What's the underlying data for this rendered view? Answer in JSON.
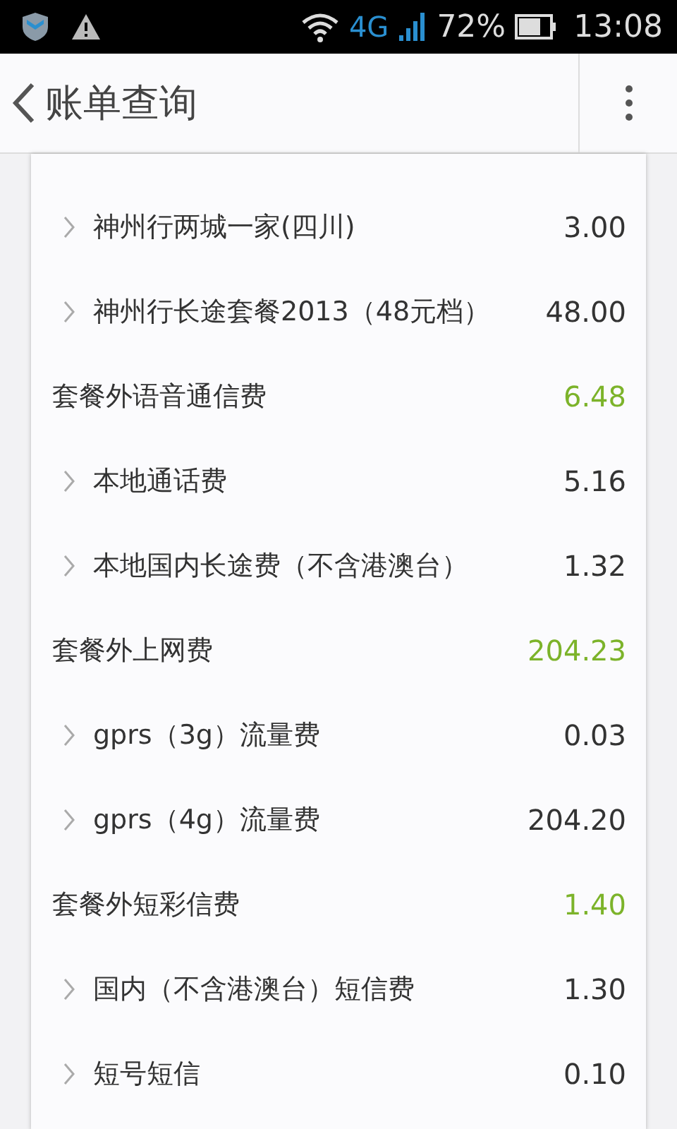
{
  "status_bar": {
    "network": "4G",
    "battery": "72%",
    "time": "13:08"
  },
  "app_bar": {
    "title": "账单查询"
  },
  "rows": [
    {
      "kind": "item",
      "label": "神州行两城一家(四川)",
      "amount": "3.00"
    },
    {
      "kind": "item",
      "label": "神州行长途套餐2013（48元档）",
      "amount": "48.00"
    },
    {
      "kind": "category",
      "label": "套餐外语音通信费",
      "amount": "6.48"
    },
    {
      "kind": "item",
      "label": "本地通话费",
      "amount": "5.16"
    },
    {
      "kind": "item",
      "label": "本地国内长途费（不含港澳台）",
      "amount": "1.32"
    },
    {
      "kind": "category",
      "label": "套餐外上网费",
      "amount": "204.23"
    },
    {
      "kind": "item",
      "label": "gprs（3g）流量费",
      "amount": "0.03"
    },
    {
      "kind": "item",
      "label": "gprs（4g）流量费",
      "amount": "204.20"
    },
    {
      "kind": "category",
      "label": "套餐外短彩信费",
      "amount": "1.40"
    },
    {
      "kind": "item",
      "label": "国内（不含港澳台）短信费",
      "amount": "1.30"
    },
    {
      "kind": "item",
      "label": "短号短信",
      "amount": "0.10"
    }
  ]
}
